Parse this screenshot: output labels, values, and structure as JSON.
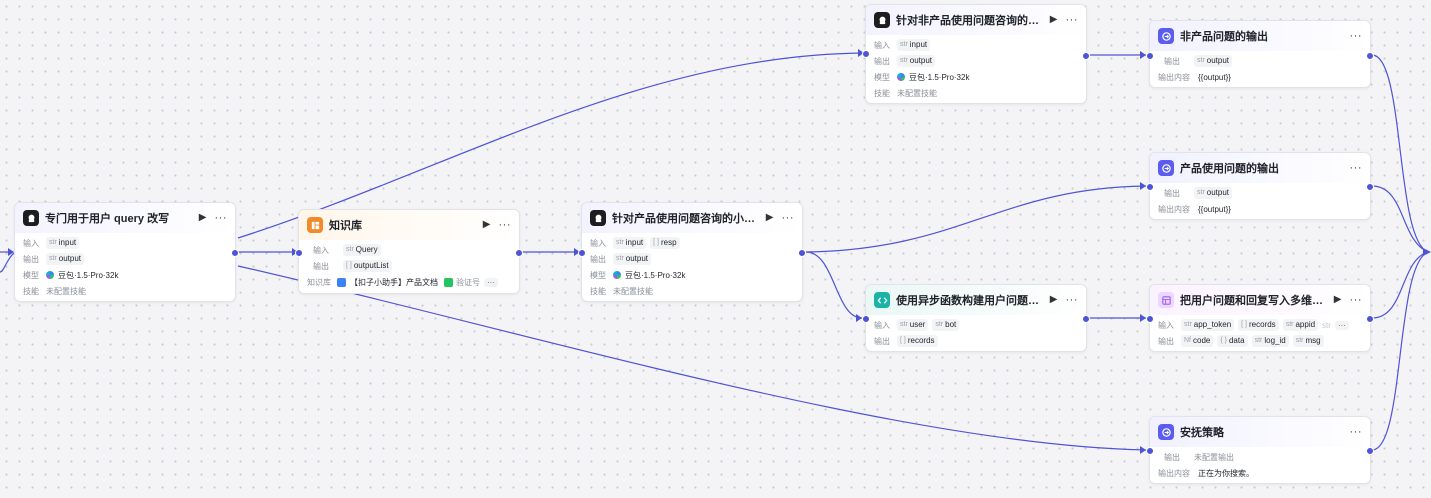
{
  "labels": {
    "input": "输入",
    "output": "输出",
    "model": "模型",
    "skills": "技能",
    "kb": "知识库",
    "output_content": "输出内容"
  },
  "common": {
    "str": "str",
    "list": "[ ]",
    "no_skills": "未配置技能",
    "model_name": "豆包·1.5·Pro·32k"
  },
  "nodes": {
    "rewrite": {
      "title": "专门用于用户 query 改写",
      "input_var": "input",
      "output_var": "output"
    },
    "kb": {
      "title": "知识库",
      "input_var": "Query",
      "output_var": "outputList",
      "kb_item_1": "【扣子小助手】产品文档",
      "kb_item_2": "验证号"
    },
    "product_llm": {
      "title": "针对产品使用问题咨询的小助手回答",
      "input_var": "input",
      "input_var2": "resp",
      "output_var": "output"
    },
    "nonproduct_llm": {
      "title": "针对非产品使用问题咨询的通用回答",
      "input_var": "input",
      "output_var": "output"
    },
    "code": {
      "title": "使用异步函数构建用户问题和回复",
      "input_var": "user",
      "input_var2": "bot",
      "output_var": "records"
    },
    "out_nonproduct": {
      "title": "非产品问题的输出",
      "output_var": "output",
      "content": "{{output}}"
    },
    "out_product": {
      "title": "产品使用问题的输出",
      "output_var": "output",
      "content": "{{output}}"
    },
    "plugin": {
      "title": "把用户问题和回复写入多维表格",
      "input_var": "app_token",
      "input_var2": "records",
      "input_var3": "appid",
      "input_var4": "str",
      "output_var": "code",
      "output_var2": "data",
      "output_var3": "log_id",
      "output_var4": "msg",
      "num": "Nf",
      "obj": "{ }"
    },
    "soothe": {
      "title": "安抚策略",
      "output_none": "未配置输出",
      "content": "正在为你搜索。"
    }
  },
  "colors": {
    "edge": "#4e54d6",
    "canvas": "#f4f4f6"
  }
}
